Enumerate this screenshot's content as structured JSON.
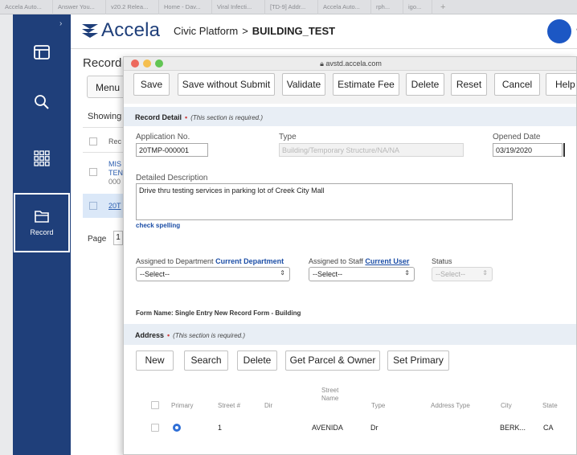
{
  "browser": {
    "tabs": [
      "Accela Auto...",
      "Answer You...",
      "v20.2 Relea...",
      "Home - Dav...",
      "Viral Infecti...",
      "[TD-9] Addr...",
      "Accela Auto...",
      "rph...",
      "igo..."
    ],
    "new_tab": "+"
  },
  "sidebar": {
    "expand_icon": "chevron-right-icon",
    "items": [
      {
        "icon": "panel-icon",
        "label": ""
      },
      {
        "icon": "search-icon",
        "label": ""
      },
      {
        "icon": "apps-grid-icon",
        "label": ""
      },
      {
        "icon": "record-folder-icon",
        "label": "Record"
      }
    ]
  },
  "header": {
    "logo_text": "Accela",
    "product": "Civic Platform",
    "separator": ">",
    "module": "BUILDING_TEST",
    "avatar_color": "#1c57c4"
  },
  "background_page": {
    "title": "Record",
    "menu_label": "Menu",
    "showing_label": "Showing",
    "col_label": "Rec",
    "row1": [
      "MIS",
      "TEN",
      "000"
    ],
    "row2_link": "20T",
    "page_label": "Page",
    "page_number": "1"
  },
  "popup": {
    "url": "avstd.accela.com",
    "toolbar": {
      "save": "Save",
      "save_without_submit": "Save without Submit",
      "validate": "Validate",
      "estimate_fee": "Estimate Fee",
      "delete": "Delete",
      "reset": "Reset",
      "cancel": "Cancel",
      "help": "Help"
    },
    "record_detail": {
      "title": "Record Detail",
      "required_mark": "•",
      "required_note": "(This section is required.)",
      "application_no_label": "Application No.",
      "application_no_value": "20TMP-000001",
      "type_label": "Type",
      "type_value": "Building/Temporary Structure/NA/NA",
      "opened_date_label": "Opened Date",
      "opened_date_value": "03/19/2020",
      "description_label": "Detailed Description",
      "description_value": "Drive thru testing services in parking lot of Creek City Mall",
      "check_spelling": "check spelling",
      "dept_label": "Assigned to Department",
      "dept_link": "Current Department",
      "dept_value": "--Select--",
      "staff_label": "Assigned to Staff",
      "staff_link": "Current User",
      "staff_value": "--Select--",
      "status_label": "Status",
      "status_value": "--Select--",
      "form_name": "Form Name: Single Entry New Record Form - Building"
    },
    "address": {
      "title": "Address",
      "required_mark": "•",
      "required_note": "(This section is required.)",
      "buttons": {
        "new": "New",
        "search": "Search",
        "delete": "Delete",
        "get_parcel": "Get Parcel & Owner",
        "set_primary": "Set Primary"
      },
      "columns": {
        "primary": "Primary",
        "street_no": "Street #",
        "dir": "Dir",
        "street_name": "Street Name",
        "type": "Type",
        "address_type": "Address Type",
        "city": "City",
        "state": "State"
      },
      "rows": [
        {
          "primary": true,
          "street_no": "1",
          "dir": "",
          "street_name": "AVENIDA",
          "type": "Dr",
          "address_type": "",
          "city": "BERK...",
          "state": "CA"
        }
      ]
    }
  }
}
